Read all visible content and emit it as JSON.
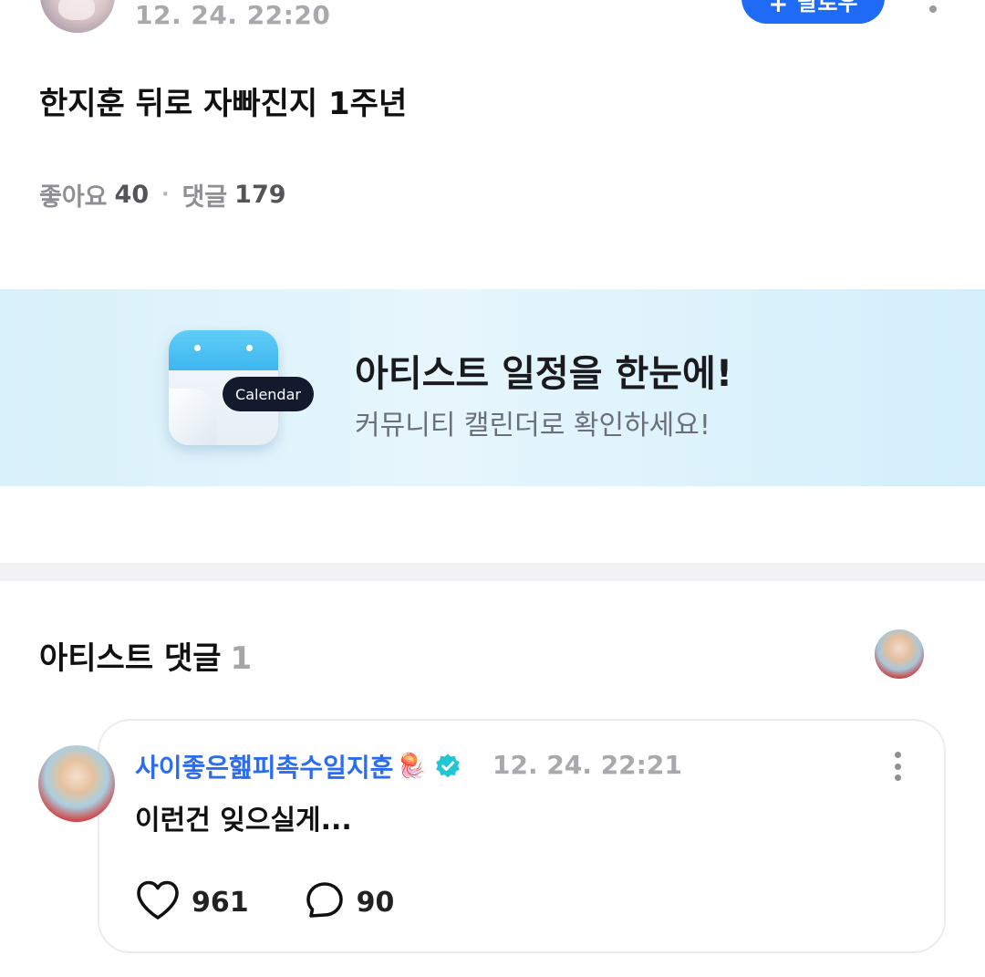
{
  "post": {
    "date": "12. 24. 22:20",
    "follow_label": "팔로우",
    "title": "한지훈 뒤로 자빠진지 1주년",
    "likes_label": "좋아요",
    "likes_count": "40",
    "separator": "·",
    "comments_label": "댓글",
    "comments_count": "179"
  },
  "banner": {
    "badge": "Calendar",
    "title": "아티스트 일정을 한눈에!",
    "subtitle": "커뮤니티 캘린더로 확인하세요!"
  },
  "artist_comments": {
    "title": "아티스트 댓글",
    "count": "1",
    "comment": {
      "author": "사이좋은햂피촉수일지훈",
      "author_emoji": "🪼",
      "date": "12. 24. 22:21",
      "text": "이런건 잊으실게...",
      "like_count": "961",
      "reply_count": "90"
    }
  },
  "colors": {
    "accent": "#1f6bf5",
    "author_name": "#2c6cf0",
    "verified_badge": "#1fc7d4"
  }
}
